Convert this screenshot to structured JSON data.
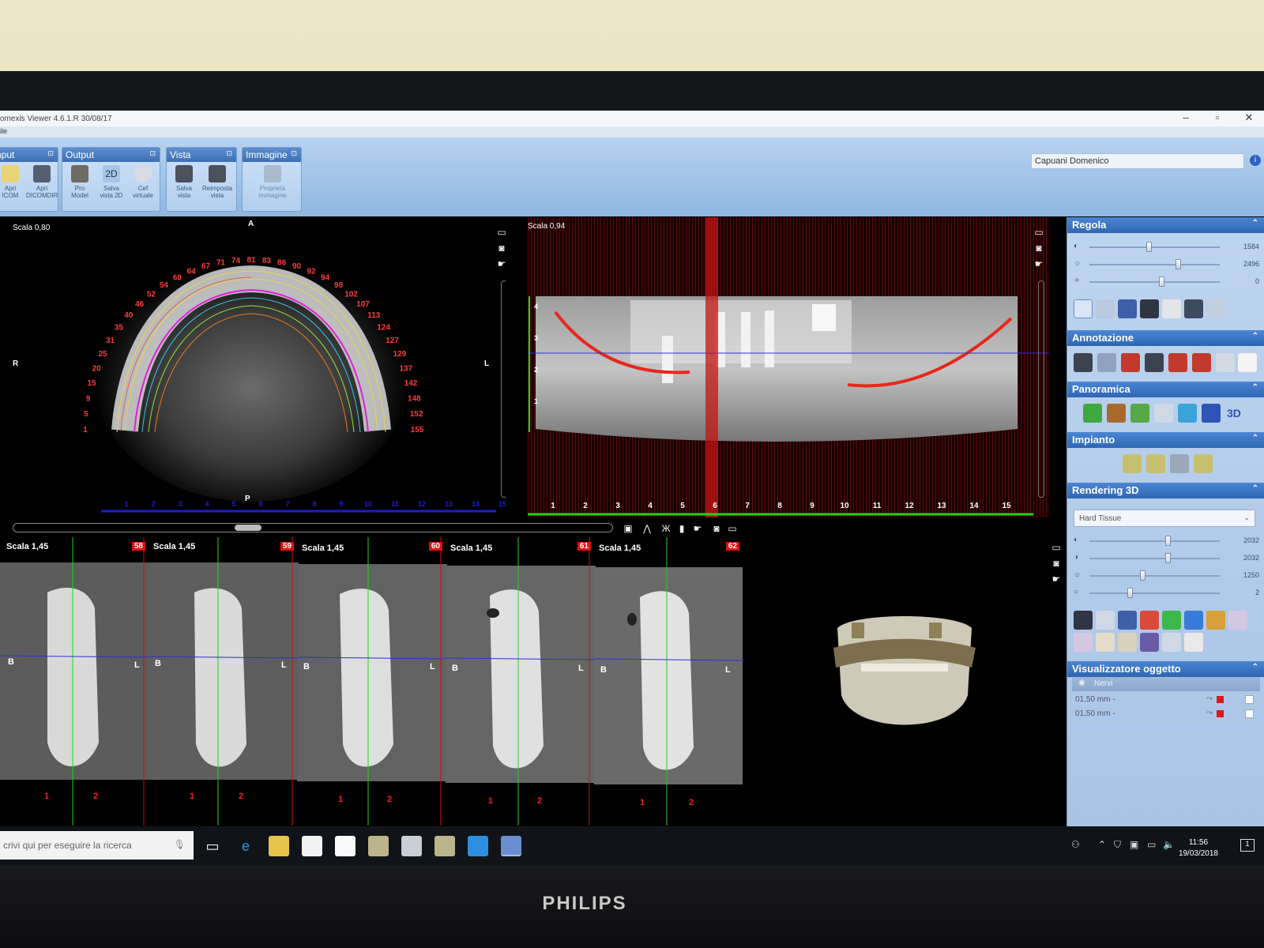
{
  "window": {
    "title": "omexis Viewer 4.6.1.R  30/08/17",
    "menu_file": "ile",
    "user": "Capuani Domenico",
    "info": "i"
  },
  "ribbon": {
    "groups": [
      {
        "title": "nput",
        "buttons": [
          "Apri\nICOM",
          "Apri\nDICOMDIR"
        ]
      },
      {
        "title": "Output",
        "buttons": [
          "Pro\nModel",
          "Salva\nvista 2D",
          "Cef\nvirtuale"
        ]
      },
      {
        "title": "Vista",
        "buttons": [
          "Salva\nvista",
          "Reimposta\nvista"
        ]
      },
      {
        "title": "Immagine",
        "buttons": [
          "Proprietà\nimmagine"
        ]
      }
    ]
  },
  "axial_view": {
    "scale": "Scala 0,80",
    "orient": {
      "top": "A",
      "bottom": "P",
      "left": "R",
      "right": "L"
    },
    "arch_numbers": [
      "1",
      "5",
      "9",
      "15",
      "20",
      "25",
      "31",
      "35",
      "40",
      "46",
      "52",
      "54",
      "60",
      "64",
      "67",
      "71",
      "74",
      "81",
      "83",
      "86",
      "90",
      "92",
      "94",
      "98",
      "102",
      "107",
      "113",
      "124",
      "127",
      "129",
      "137",
      "142",
      "148",
      "152",
      "155"
    ],
    "ruler_ticks": [
      "1",
      "2",
      "3",
      "4",
      "5",
      "6",
      "7",
      "8",
      "9",
      "10",
      "11",
      "12",
      "13",
      "14",
      "15"
    ]
  },
  "pano_view": {
    "scale": "Scala 0,94",
    "ruler_ticks": [
      "1",
      "2",
      "3",
      "4",
      "5",
      "6",
      "7",
      "8",
      "9",
      "10",
      "11",
      "12",
      "13",
      "14",
      "15"
    ],
    "vertical_ticks": [
      "4",
      "3",
      "2",
      "1"
    ]
  },
  "cross_sections": [
    {
      "scale": "Scala 1,45",
      "num": "58"
    },
    {
      "scale": "Scala 1,45",
      "num": "59"
    },
    {
      "scale": "Scala 1,45",
      "num": "60"
    },
    {
      "scale": "Scala 1,45",
      "num": "61"
    },
    {
      "scale": "Scala 1,45",
      "num": "62"
    }
  ],
  "cross_labels": {
    "buccal": "B",
    "lingual": "L",
    "tick1": "1",
    "tick2": "2"
  },
  "panel": {
    "regola": {
      "title": "Regola",
      "sliders": [
        {
          "value": "1584",
          "level": 0.45
        },
        {
          "value": "2496",
          "level": 0.68
        },
        {
          "value": "0",
          "level": 0.55
        }
      ]
    },
    "annotazione": {
      "title": "Annotazione"
    },
    "panoramica": {
      "title": "Panoramica",
      "label_3d": "3D"
    },
    "impianto": {
      "title": "Impianto"
    },
    "rendering": {
      "title": "Rendering 3D",
      "preset": "Hard Tissue",
      "sliders": [
        {
          "value": "2032",
          "level": 0.6
        },
        {
          "value": "2032",
          "level": 0.6
        },
        {
          "value": "1250",
          "level": 0.4
        },
        {
          "value": "2",
          "level": 0.3
        }
      ]
    },
    "visualizzatore": {
      "title": "Visualizzatore oggetto",
      "header": "Nervi",
      "rows": [
        "01,50 mm -",
        "01,50 mm -"
      ]
    }
  },
  "taskbar": {
    "search_placeholder": "crivi qui per eseguire la ricerca",
    "time": "11:56",
    "date": "19/03/2018",
    "notifications": "1"
  },
  "monitor": {
    "brand": "PHILIPS"
  },
  "colors": {
    "accent": "#2f66b3",
    "nerve": "#e8281c",
    "cursor_line": "#23d21f",
    "ruler": "#1b1bd8"
  }
}
